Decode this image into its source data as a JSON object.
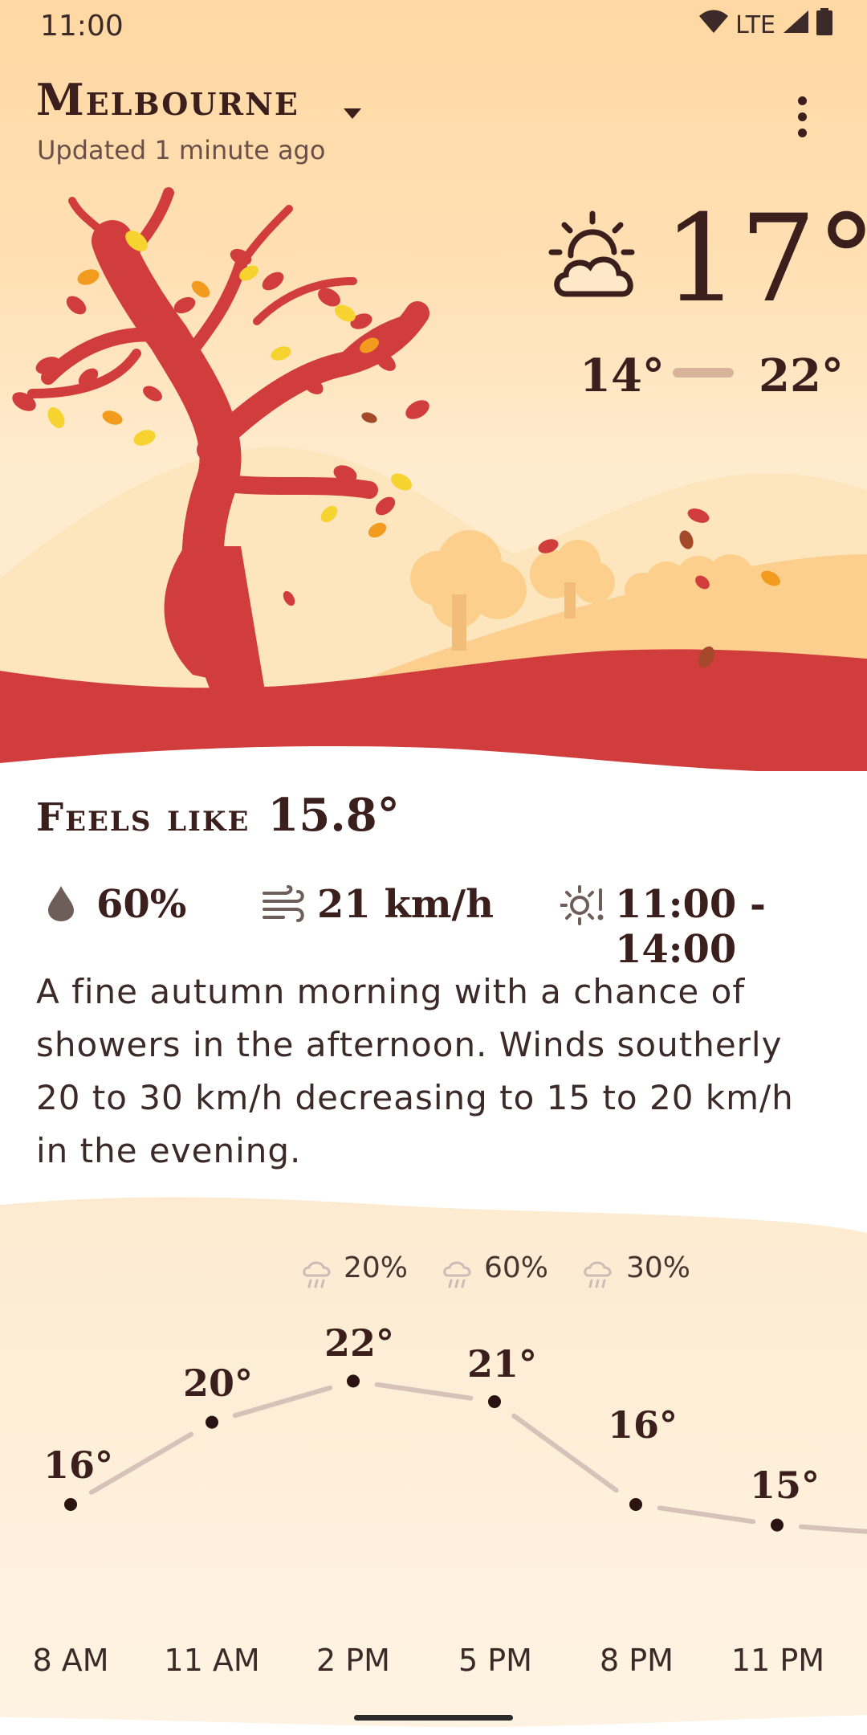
{
  "status_bar": {
    "time": "11:00",
    "network": "LTE"
  },
  "header": {
    "city": "Melbourne",
    "updated": "Updated 1 minute ago"
  },
  "current": {
    "temp": "17°",
    "low": "14°",
    "high": "22°",
    "condition_icon": "partly-cloudy-day-icon"
  },
  "details": {
    "feels_like_label": "Feels like",
    "feels_like_value": "15.8°",
    "humidity": "60%",
    "wind": "21 km/h",
    "uv_window": "11:00 - 14:00",
    "summary": "A fine autumn morning with a chance of showers in the afternoon. Winds southerly 20 to 30 km/h decreasing to 15 to 20 km/h in the evening."
  },
  "forecast": {
    "rain": [
      {
        "label": "20%"
      },
      {
        "label": "60%"
      },
      {
        "label": "30%"
      }
    ],
    "hours": [
      {
        "time": "8 AM",
        "temp": "16°",
        "value": 16
      },
      {
        "time": "11 AM",
        "temp": "20°",
        "value": 20
      },
      {
        "time": "2 PM",
        "temp": "22°",
        "value": 22
      },
      {
        "time": "5 PM",
        "temp": "21°",
        "value": 21
      },
      {
        "time": "8 PM",
        "temp": "16°",
        "value": 16
      },
      {
        "time": "11 PM",
        "temp": "15°",
        "value": 15
      }
    ]
  },
  "colors": {
    "accent_red": "#d13d3d",
    "text_dark": "#3b1f1c",
    "sand": "#ffd8a3"
  }
}
